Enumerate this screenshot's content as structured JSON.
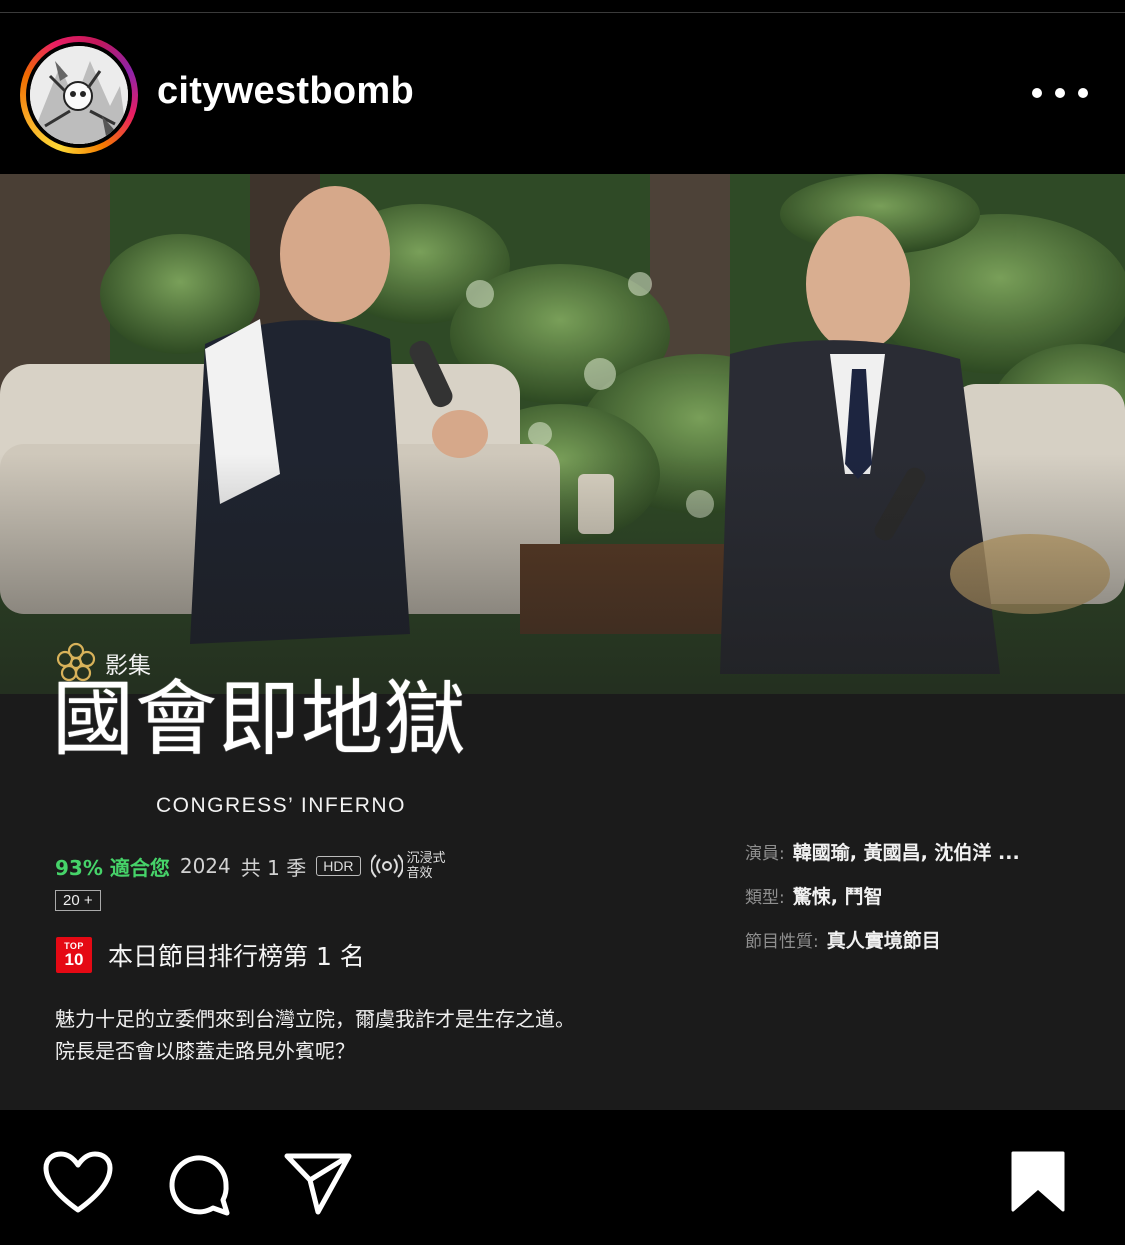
{
  "post": {
    "username": "citywestbomb",
    "more_icon": "more-horizontal-icon"
  },
  "show": {
    "category": "影集",
    "title": "國會即地獄",
    "subtitle": "CONGRESS’ INFERNO",
    "match": "93% 適合您",
    "year": "2024",
    "seasons": "共 1 季",
    "hdr": "HDR",
    "audio_line1": "沉浸式",
    "audio_line2": "音效",
    "rating": "20 +",
    "top10_badge_top": "TOP",
    "top10_badge_num": "10",
    "rank_text": "本日節目排行榜第 1 名",
    "synopsis_line1": "魅力十足的立委們來到台灣立院，爾虞我詐才是生存之道。",
    "synopsis_line2": "院長是否會以膝蓋走路見外賓呢？",
    "cast_label": "演員:",
    "cast_value": "韓國瑜, 黃國昌, 沈伯洋 ...",
    "genre_label": "類型:",
    "genre_value": "驚悚, 鬥智",
    "type_label": "節目性質:",
    "type_value": "真人實境節目"
  },
  "actions": {
    "like_icon": "heart-icon",
    "comment_icon": "comment-icon",
    "share_icon": "send-icon",
    "save_icon": "bookmark-icon"
  },
  "colors": {
    "background": "#000000",
    "match_green": "#46d369",
    "top10_red": "#e50914",
    "label_grey": "#8f8f8f"
  }
}
